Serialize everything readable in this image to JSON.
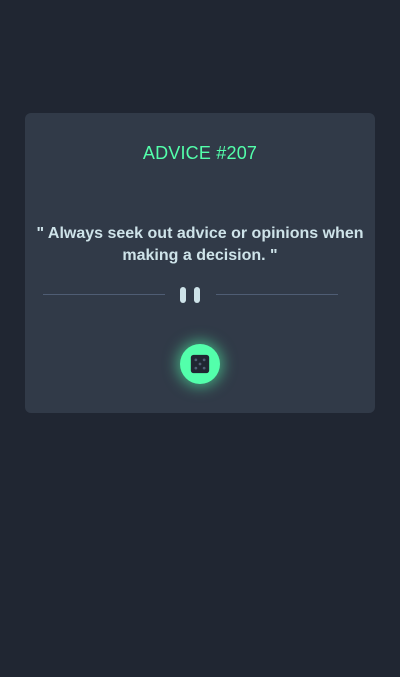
{
  "advice": {
    "id_label": "ADVICE #207",
    "text": "\" Always seek out advice or opinions when making a decision. \""
  },
  "icons": {
    "divider": "pause-icon",
    "button": "dice-icon"
  },
  "colors": {
    "background": "#202632",
    "card": "#313a48",
    "accent": "#53ffab",
    "text": "#cee3e9",
    "divider_line": "#4f5d74"
  }
}
